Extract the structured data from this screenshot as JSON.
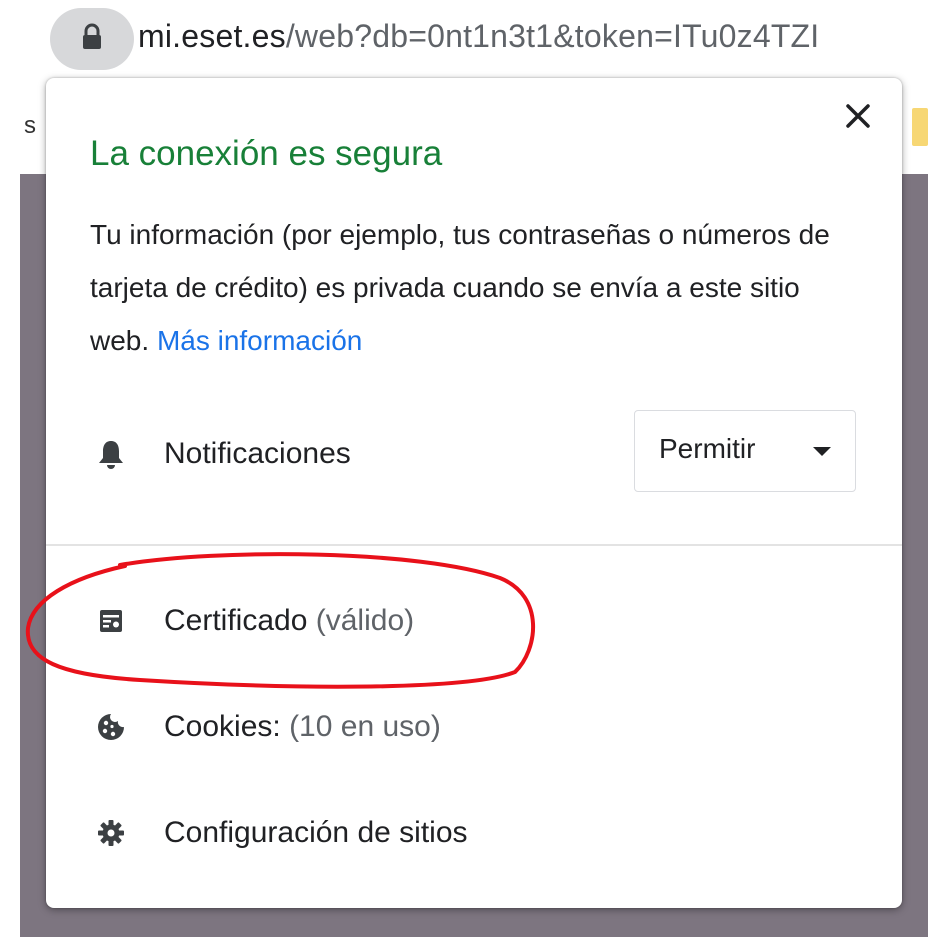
{
  "address_bar": {
    "url_host": "mi.eset.es",
    "url_path": "/web?db=0nt1n3t1&token=ITu0z4TZI",
    "lock_icon": "lock-icon"
  },
  "background": {
    "bookmark_fragment": "s"
  },
  "popup": {
    "title": "La conexión es segura",
    "description": "Tu información (por ejemplo, tus contraseñas o números de tarjeta de crédito) es privada cuando se envía a este sitio web.",
    "more_info_link": "Más información",
    "close_icon": "close-icon",
    "notifications": {
      "icon": "bell-icon",
      "label": "Notificaciones",
      "permission_value": "Permitir"
    },
    "certificate": {
      "icon": "certificate-icon",
      "label": "Certificado",
      "status": "(válido)"
    },
    "cookies": {
      "icon": "cookie-icon",
      "label": "Cookies:",
      "status": "(10 en uso)"
    },
    "site_settings": {
      "icon": "gear-icon",
      "label": "Configuración de sitios"
    }
  },
  "colors": {
    "title_green": "#188038",
    "link_blue": "#1a73e8",
    "annotation_red": "#e8111a",
    "page_background": "#7d7580"
  }
}
